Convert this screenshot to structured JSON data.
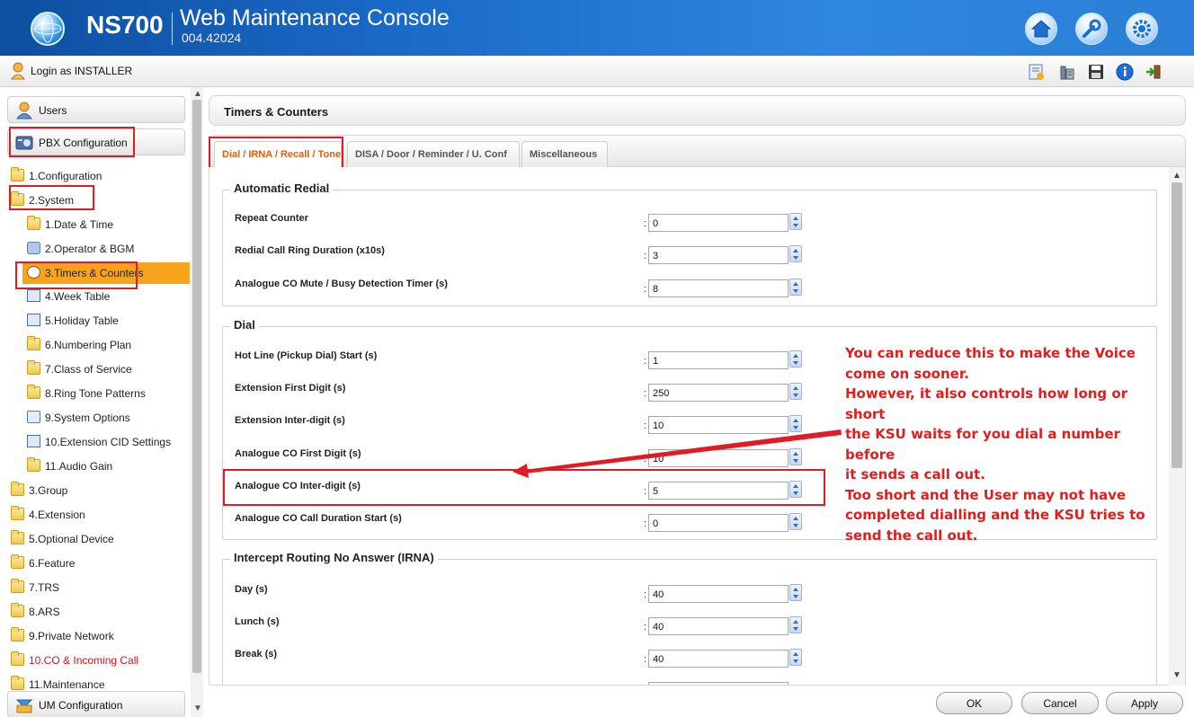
{
  "header": {
    "product": "NS700",
    "title": "Web Maintenance Console",
    "version": "004.42024",
    "buttons": [
      "home-icon",
      "wrench-icon",
      "gear-icon"
    ]
  },
  "userbar": {
    "login_label": "Login as INSTALLER",
    "toolbar_icons": [
      "status-icon",
      "phone-icon",
      "save-icon",
      "info-icon",
      "logout-icon"
    ]
  },
  "sidebar": {
    "users_label": "Users",
    "pbx_label": "PBX Configuration",
    "items": [
      {
        "label": "1.Configuration",
        "level": 0
      },
      {
        "label": "2.System",
        "level": 0
      },
      {
        "label": "1.Date & Time",
        "level": 1
      },
      {
        "label": "2.Operator & BGM",
        "level": 1
      },
      {
        "label": "3.Timers & Counters",
        "level": 1
      },
      {
        "label": "4.Week Table",
        "level": 1
      },
      {
        "label": "5.Holiday Table",
        "level": 1
      },
      {
        "label": "6.Numbering Plan",
        "level": 1
      },
      {
        "label": "7.Class of Service",
        "level": 1
      },
      {
        "label": "8.Ring Tone Patterns",
        "level": 1
      },
      {
        "label": "9.System Options",
        "level": 1
      },
      {
        "label": "10.Extension CID Settings",
        "level": 1
      },
      {
        "label": "11.Audio Gain",
        "level": 1
      },
      {
        "label": "3.Group",
        "level": 0
      },
      {
        "label": "4.Extension",
        "level": 0
      },
      {
        "label": "5.Optional Device",
        "level": 0
      },
      {
        "label": "6.Feature",
        "level": 0
      },
      {
        "label": "7.TRS",
        "level": 0
      },
      {
        "label": "8.ARS",
        "level": 0
      },
      {
        "label": "9.Private Network",
        "level": 0
      },
      {
        "label": "10.CO & Incoming Call",
        "level": 0
      },
      {
        "label": "11.Maintenance",
        "level": 0
      }
    ],
    "um_label": "UM Configuration"
  },
  "main": {
    "title": "Timers & Counters",
    "tabs": [
      {
        "label": "Dial / IRNA / Recall / Tone",
        "active": true
      },
      {
        "label": "DISA / Door / Reminder / U. Conf",
        "active": false
      },
      {
        "label": "Miscellaneous",
        "active": false
      }
    ],
    "sections": {
      "redial": {
        "legend": "Automatic Redial",
        "rows": [
          {
            "label": "Repeat Counter",
            "value": "0"
          },
          {
            "label": "Redial Call Ring Duration (x10s)",
            "value": "3"
          },
          {
            "label": "Analogue CO Mute / Busy Detection Timer (s)",
            "value": "8"
          }
        ]
      },
      "dial": {
        "legend": "Dial",
        "rows": [
          {
            "label": "Hot Line (Pickup Dial) Start (s)",
            "value": "1"
          },
          {
            "label": "Extension First Digit (s)",
            "value": "250"
          },
          {
            "label": "Extension Inter-digit (s)",
            "value": "10"
          },
          {
            "label": "Analogue CO First Digit (s)",
            "value": "10"
          },
          {
            "label": "Analogue CO Inter-digit (s)",
            "value": "5"
          },
          {
            "label": "Analogue CO Call Duration Start (s)",
            "value": "0"
          }
        ]
      },
      "irna": {
        "legend": "Intercept Routing No Answer (IRNA)",
        "rows": [
          {
            "label": "Day (s)",
            "value": "40"
          },
          {
            "label": "Lunch (s)",
            "value": "40"
          },
          {
            "label": "Break (s)",
            "value": "40"
          }
        ]
      }
    }
  },
  "annotation": {
    "lines": [
      "You can reduce this to make the Voice",
      "come on sooner.",
      "However, it also controls how long or short",
      "the KSU waits for you dial a number before",
      "it sends a call out.",
      "Too short and the User may not have",
      "completed dialling and the KSU tries to",
      "send the call out."
    ],
    "color": "#e11d1d"
  },
  "buttons": {
    "ok": "OK",
    "cancel": "Cancel",
    "apply": "Apply"
  },
  "colors": {
    "accent": "#f7a31c",
    "highlight": "#e01b24",
    "header": "#1b6bc9"
  }
}
